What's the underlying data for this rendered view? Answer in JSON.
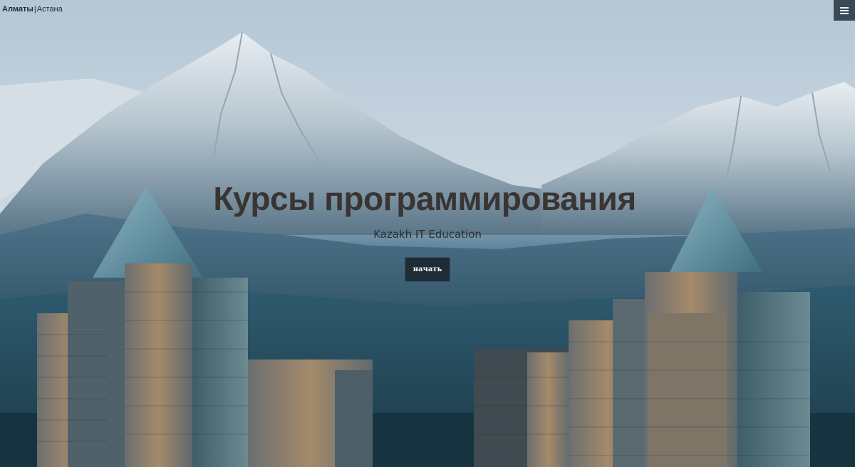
{
  "header": {
    "cities": [
      {
        "label": "Алматы",
        "active": true
      },
      {
        "label": "Астана",
        "active": false
      }
    ],
    "separator": "|",
    "menu_icon": "hamburger-menu-icon"
  },
  "hero": {
    "title": "Курсы программирования",
    "subtitle": "Kazakh IT Education",
    "cta_label": "начать",
    "background_image": "mountains-and-skyscrapers-photo"
  },
  "colors": {
    "title": "#3a3532",
    "button_bg": "#1e2c36",
    "button_text": "#ffffff",
    "menu_bg": "#3a4a55"
  }
}
